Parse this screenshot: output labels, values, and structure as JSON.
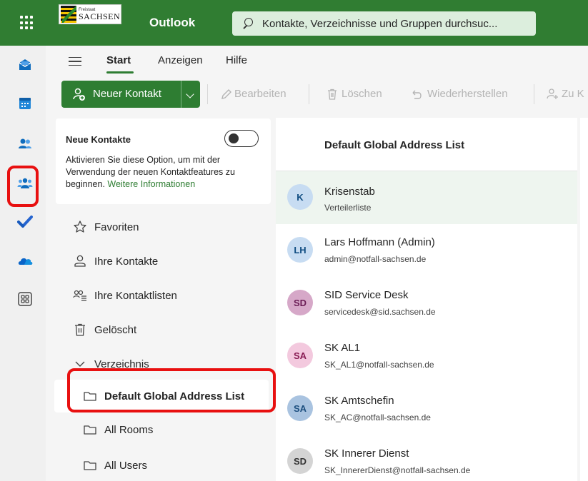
{
  "topbar": {
    "logo_small": "Freistaat",
    "logo_big": "SACHSEN",
    "app_name": "Outlook",
    "search_placeholder": "Kontakte, Verzeichnisse und Gruppen durchsuc..."
  },
  "ribbon": {
    "tabs": [
      {
        "label": "Start",
        "active": true
      },
      {
        "label": "Anzeigen",
        "active": false
      },
      {
        "label": "Hilfe",
        "active": false
      }
    ],
    "commands": {
      "new_contact": "Neuer Kontakt",
      "edit": "Bearbeiten",
      "delete": "Löschen",
      "restore": "Wiederherstellen",
      "add_to": "Zu K"
    }
  },
  "rail": {
    "items": [
      "mail-icon",
      "calendar-icon",
      "people-icon",
      "groups-icon",
      "todo-icon",
      "onedrive-icon",
      "apps-icon"
    ],
    "accent": "#2e7d32",
    "highlight_color": "#e81010"
  },
  "nav": {
    "new_contacts_title": "Neue Kontakte",
    "new_contacts_desc": "Aktivieren Sie diese Option, um mit der Verwendung der neuen Kontaktfeatures zu beginnen.",
    "new_contacts_link": "Weitere Informationen",
    "toggle_on": false,
    "items": [
      {
        "label": "Favoriten",
        "icon": "star-icon"
      },
      {
        "label": "Ihre Kontakte",
        "icon": "person-icon"
      },
      {
        "label": "Ihre Kontaktlisten",
        "icon": "contact-list-icon"
      },
      {
        "label": "Gelöscht",
        "icon": "trash-icon"
      },
      {
        "label": "Verzeichnis",
        "icon": "chevron-down-icon"
      }
    ],
    "directory": [
      {
        "label": "Default Global Address List",
        "selected": true
      },
      {
        "label": "All Rooms",
        "selected": false
      },
      {
        "label": "All Users",
        "selected": false
      }
    ]
  },
  "list": {
    "header": "Default Global Address List",
    "contacts": [
      {
        "initials": "K",
        "name": "Krisenstab",
        "detail": "Verteilerliste",
        "bg": "#c7dcf2",
        "fg": "#0f4c81"
      },
      {
        "initials": "LH",
        "name": "Lars Hoffmann (Admin)",
        "detail": "admin@notfall-sachsen.de",
        "bg": "#c7dcf2",
        "fg": "#0f4c81"
      },
      {
        "initials": "SD",
        "name": "SID Service Desk",
        "detail": "servicedesk@sid.sachsen.de",
        "bg": "#d6a8c8",
        "fg": "#6b1d56"
      },
      {
        "initials": "SA",
        "name": "SK AL1",
        "detail": "SK_AL1@notfall-sachsen.de",
        "bg": "#f3c9de",
        "fg": "#8a1e55"
      },
      {
        "initials": "SA",
        "name": "SK Amtschefin",
        "detail": "SK_AC@notfall-sachsen.de",
        "bg": "#a9c3e0",
        "fg": "#1d4f7f"
      },
      {
        "initials": "SD",
        "name": "SK Innerer Dienst",
        "detail": "SK_InnererDienst@notfall-sachsen.de",
        "bg": "#d4d4d4",
        "fg": "#333333"
      }
    ]
  }
}
